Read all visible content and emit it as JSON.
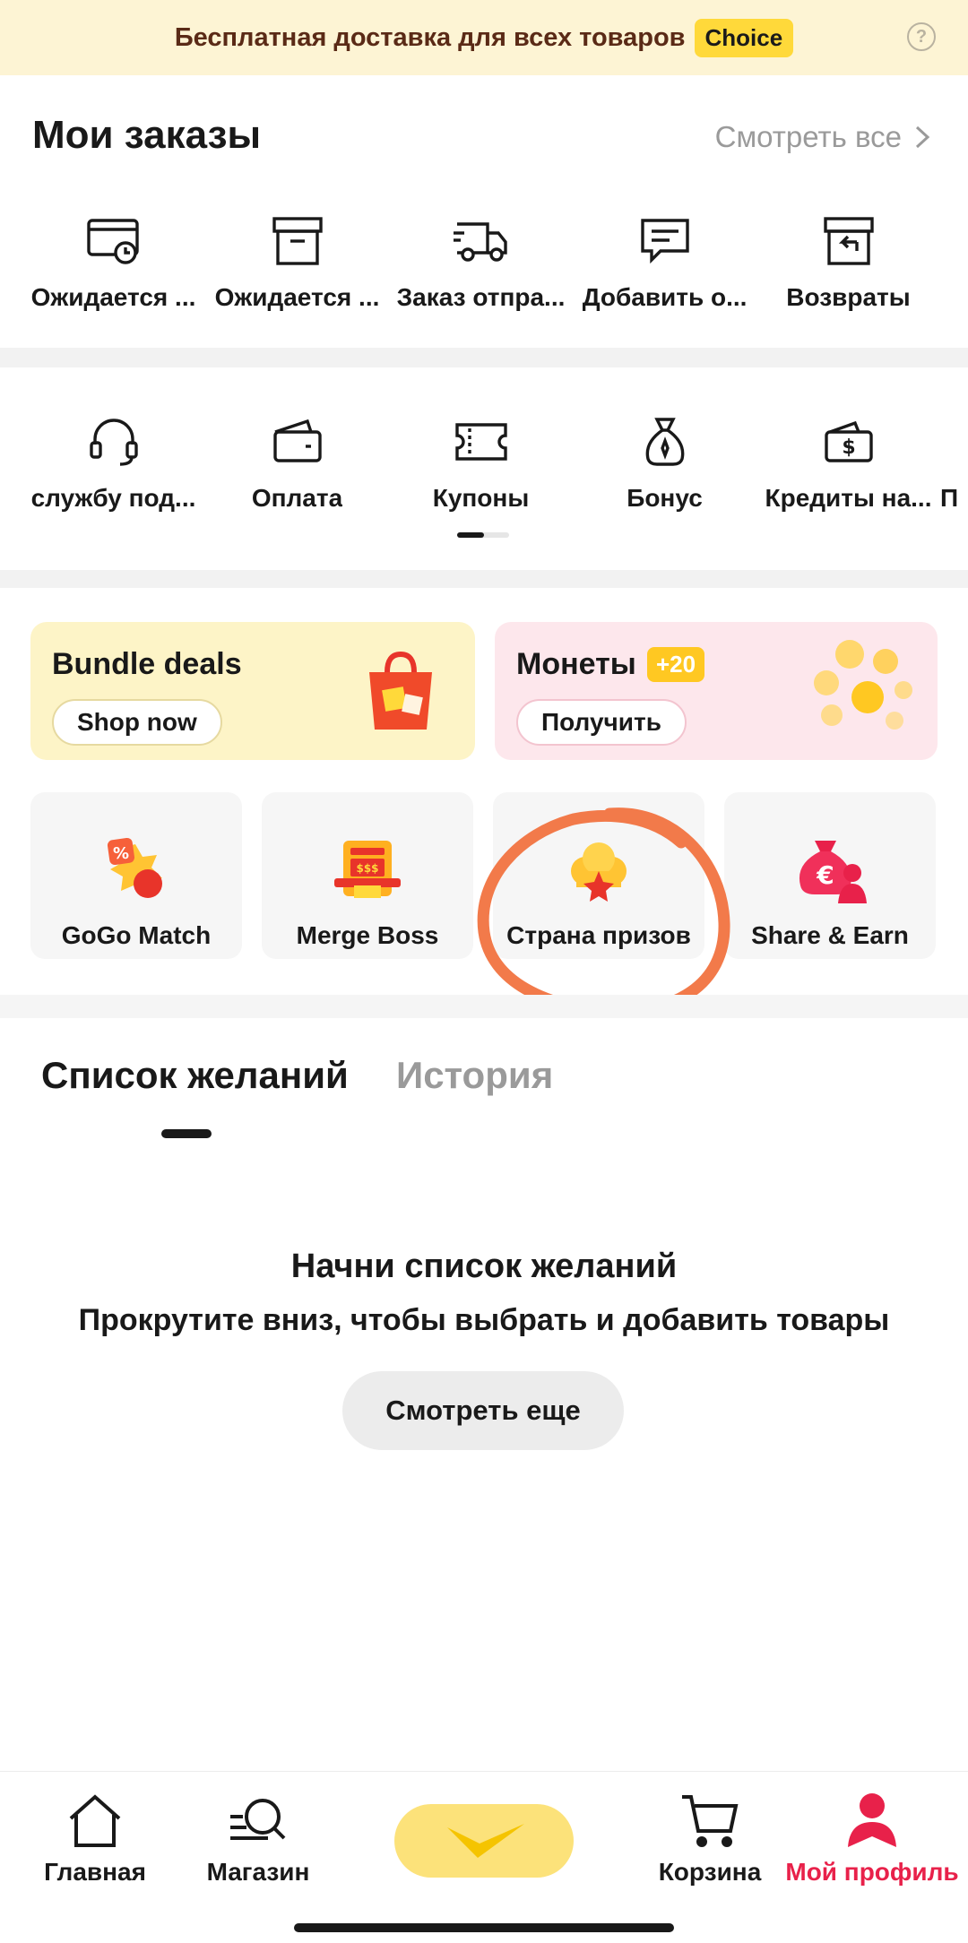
{
  "promo": {
    "text": "Бесплатная доставка для всех товаров",
    "badge": "Choice",
    "help": "?"
  },
  "orders": {
    "title": "Мои заказы",
    "view_all": "Смотреть все",
    "items": [
      {
        "label": "Ожидается ...",
        "icon": "card-clock-icon"
      },
      {
        "label": "Ожидается ...",
        "icon": "box-icon"
      },
      {
        "label": "Заказ отпра...",
        "icon": "truck-icon"
      },
      {
        "label": "Добавить о...",
        "icon": "review-icon"
      },
      {
        "label": "Возвраты",
        "icon": "return-icon"
      }
    ]
  },
  "services": {
    "items": [
      {
        "label": "службу под...",
        "icon": "headset-icon"
      },
      {
        "label": "Оплата",
        "icon": "wallet-icon"
      },
      {
        "label": "Купоны",
        "icon": "coupon-icon"
      },
      {
        "label": "Бонус",
        "icon": "bonus-bag-icon"
      },
      {
        "label": "Кредиты на...",
        "icon": "credit-wallet-icon"
      },
      {
        "label": "П",
        "icon": ""
      }
    ]
  },
  "cards": {
    "bundle": {
      "title": "Bundle deals",
      "button": "Shop now"
    },
    "coins": {
      "title": "Монеты",
      "badge": "+20",
      "button": "Получить"
    },
    "games": [
      {
        "label": "GoGo Match",
        "icon": "gogo-match-icon"
      },
      {
        "label": "Merge Boss",
        "icon": "merge-boss-icon"
      },
      {
        "label": "Страна призов",
        "icon": "prize-land-icon"
      },
      {
        "label": "Share & Earn",
        "icon": "share-earn-icon"
      }
    ]
  },
  "wishlist": {
    "tab_wishlist": "Список желаний",
    "tab_history": "История",
    "empty_title": "Начни список желаний",
    "empty_subtitle": "Прокрутите вниз, чтобы выбрать и добавить товары",
    "more_button": "Смотреть еще"
  },
  "nav": {
    "home": "Главная",
    "shop": "Магазин",
    "cart": "Корзина",
    "profile": "Мой профиль"
  },
  "colors": {
    "accent_red": "#e8214a",
    "promo_bg": "#fdf4d4",
    "choice_yellow": "#ffd93a",
    "annotation_orange": "#f27a4a"
  }
}
